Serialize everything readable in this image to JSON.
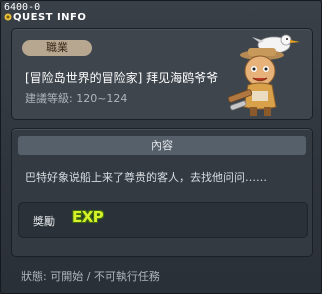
{
  "window": {
    "quest_id": "6400-0",
    "title": "QUEST INFO",
    "title_color": "#ffffff"
  },
  "quest": {
    "job_label": "職業",
    "name": "[冒险岛世界的冒险家] 拜见海鸥爷爷",
    "level_text": "建議等級: 120~124",
    "npc_icon": "captain-seagull-npc"
  },
  "content": {
    "tab_label": "內容",
    "description": "巴特好象说船上来了尊贵的客人，去找他问问……",
    "reward_label": "獎勵",
    "reward_item": "EXP",
    "reward_color": "#d7f22a"
  },
  "status": {
    "text": "狀態: 可開始 / 不可執行任務"
  }
}
